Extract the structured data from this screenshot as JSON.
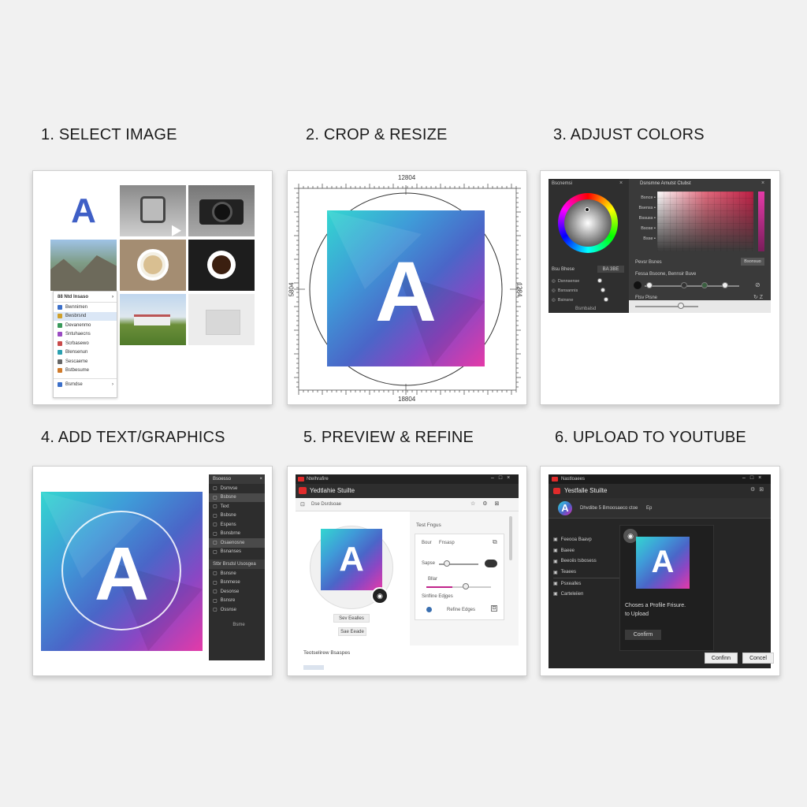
{
  "steps": [
    {
      "title": "1. SELECT IMAGE"
    },
    {
      "title": "2. CROP & RESIZE"
    },
    {
      "title": "3. ADJUST COLORS"
    },
    {
      "title": "4. ADD TEXT/GRAPHICS"
    },
    {
      "title": "5. PREVIEW & REFINE"
    },
    {
      "title": "6. UPLOAD TO YOUTUBE"
    }
  ],
  "logo_letter": "A",
  "p1": {
    "menu_header": "88 Ntd Insaso",
    "menu_items": [
      "Bwnnimen",
      "Bwsbrsnd",
      "Devanenmo",
      "Sntuhaecns",
      "Scrbasewo",
      "Blensenun",
      "Sescaeme",
      "Bstbesume"
    ],
    "menu_footer": "Bsmdse"
  },
  "p2": {
    "top_dim": "12804",
    "bottom_dim": "18804",
    "left_dim": "5804",
    "right_dim": "1284"
  },
  "p3": {
    "left_header": "Bscnemsi",
    "right_header": "Dsnsmne Arnutst Ctubst",
    "label_rows": [
      "Bsnce",
      "Bsenss",
      "Bssuss",
      "Bsose",
      "Bsse"
    ],
    "left_section": "Bsu Bhese",
    "left_btn": "BA 3BE",
    "left_rows": [
      "Dsnnsense",
      "Bsnsannis",
      "Bsinsne"
    ],
    "left_footer": "Bsmbalsd",
    "preset_label": "Pevsr Bsnes",
    "preset_btn": "Bsonsuo",
    "filter_label": "Fessa Bsoone, Bennsir Buve",
    "bottom_label": "Ftsv Pisne"
  },
  "p4": {
    "header": "Bsoesso",
    "items": [
      "Dsmvse",
      "Bsbsne",
      "Text",
      "Bsbsne",
      "Espens",
      "Bsnsbrne",
      "Osaenosne",
      "Bsnanses"
    ],
    "section": "Stbr Brsdsl Usosgea",
    "items2": [
      "Bsnsne",
      "Bsnmese",
      "Desonse",
      "Bsnsre",
      "Ossnse"
    ],
    "footer": "Bsme"
  },
  "p5": {
    "window_title": "Ntelhrafire",
    "app_title": "Yedtlahie Stuilte",
    "toolbar_label": "Dse Dsrdsoae",
    "profile_btn1": "Sev Eealles",
    "profile_btn2": "Sae Eeade",
    "right_title": "Test Fngus",
    "row_font_label": "Bour",
    "row_font_value": "Fnsasp",
    "row_size_label": "Sapse",
    "row_blur_label": "Bllar",
    "row_edges_label": "Sinfline Edjges",
    "refine_label": "Refine Edges",
    "bottom_label": "Teotselirew Bsaspes"
  },
  "p6": {
    "window_title": "Nastloaees",
    "app_title": "Yestfalle Stuilte",
    "channel_text": "Dhvdibe 5 Bmoosaeco ctoe",
    "channel_tag": "Ep",
    "menu": [
      "Feeooa Baavp",
      "Baeee",
      "Beeoiis tsbosess",
      "Teaees",
      "Psxealles",
      "Carteleiien"
    ],
    "dialog_text": "Choses a Profile Frisure.\nto Upload",
    "dialog_confirm": "Confirm",
    "footer_confirm": "Confinn",
    "footer_cancel": "Concel"
  },
  "colors": {
    "youtube_red": "#e02b2b",
    "dark_bg": "#2a2a2a",
    "accent_teal": "#33d6d0",
    "accent_pink": "#e43aa8"
  }
}
